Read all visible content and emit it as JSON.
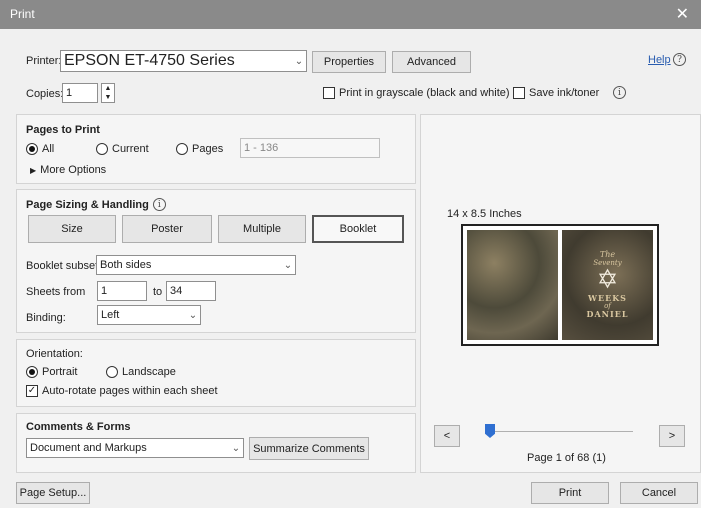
{
  "window": {
    "title": "Print",
    "close_glyph": "✕"
  },
  "printer": {
    "label": "Printer:",
    "value": "EPSON ET-4750 Series",
    "properties": "Properties",
    "advanced": "Advanced",
    "help": "Help",
    "help_glyph": "?"
  },
  "copies": {
    "label": "Copies:",
    "value": "1",
    "grayscale": "Print in grayscale (black and white)",
    "save_ink": "Save ink/toner",
    "info_glyph": "i"
  },
  "pages_to_print": {
    "heading": "Pages to Print",
    "all": "All",
    "current": "Current",
    "pages": "Pages",
    "pages_range": "1 - 136",
    "more_options": "More Options",
    "selected": "All"
  },
  "sizing": {
    "heading": "Page Sizing & Handling",
    "tabs": [
      {
        "label": "Size"
      },
      {
        "label": "Poster"
      },
      {
        "label": "Multiple"
      },
      {
        "label": "Booklet"
      }
    ],
    "selected": "Booklet",
    "booklet_subset_label": "Booklet subset:",
    "booklet_subset_value": "Both sides",
    "sheets_from_label": "Sheets from",
    "sheets_from": "1",
    "to_label": "to",
    "sheets_to": "34",
    "binding_label": "Binding:",
    "binding_value": "Left"
  },
  "orientation": {
    "label": "Orientation:",
    "portrait": "Portrait",
    "landscape": "Landscape",
    "selected": "Portrait",
    "auto_rotate": "Auto-rotate pages within each sheet",
    "auto_rotate_checked": true
  },
  "comments": {
    "heading": "Comments & Forms",
    "value": "Document and Markups",
    "summarize": "Summarize Comments"
  },
  "preview": {
    "size_label": "14 x 8.5 Inches",
    "cover_title_lines": [
      "The",
      "Seventy",
      "WEEKS",
      "of",
      "DANIEL"
    ],
    "prev": "<",
    "next": ">",
    "page_status": "Page 1 of 68 (1)",
    "slider_position": 0.0
  },
  "footer": {
    "page_setup": "Page Setup...",
    "print": "Print",
    "cancel": "Cancel"
  },
  "colors": {
    "titlebar": "#8a8a8a",
    "link": "#2a5db0",
    "cover_gold": "#d9c7a0",
    "slider": "#2f6fd1"
  }
}
